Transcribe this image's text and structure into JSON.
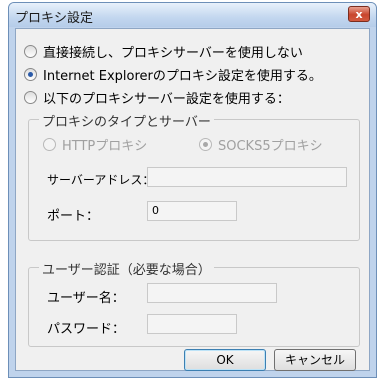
{
  "window": {
    "title": "プロキシ設定",
    "close_glyph": "x"
  },
  "proxy_mode": {
    "options": [
      {
        "label": "直接接続し、プロキシサーバーを使用しない",
        "selected": false
      },
      {
        "label": "Internet Explorerのプロキシ設定を使用する。",
        "selected": true
      },
      {
        "label": "以下のプロキシサーバー設定を使用する：",
        "selected": false
      }
    ]
  },
  "proxy_type_group": {
    "title": "プロキシのタイプとサーバー",
    "http_label": "HTTPプロキシ",
    "socks5_label": "SOCKS5プロキシ",
    "server_address_label": "サーバーアドレス：",
    "server_address_value": "",
    "port_label": "ポート：",
    "port_value": "0"
  },
  "auth_group": {
    "title": "ユーザー認証（必要な場合）",
    "username_label": "ユーザー名：",
    "username_value": "",
    "password_label": "パスワード：",
    "password_value": ""
  },
  "buttons": {
    "ok": "OK",
    "cancel": "キャンセル"
  }
}
